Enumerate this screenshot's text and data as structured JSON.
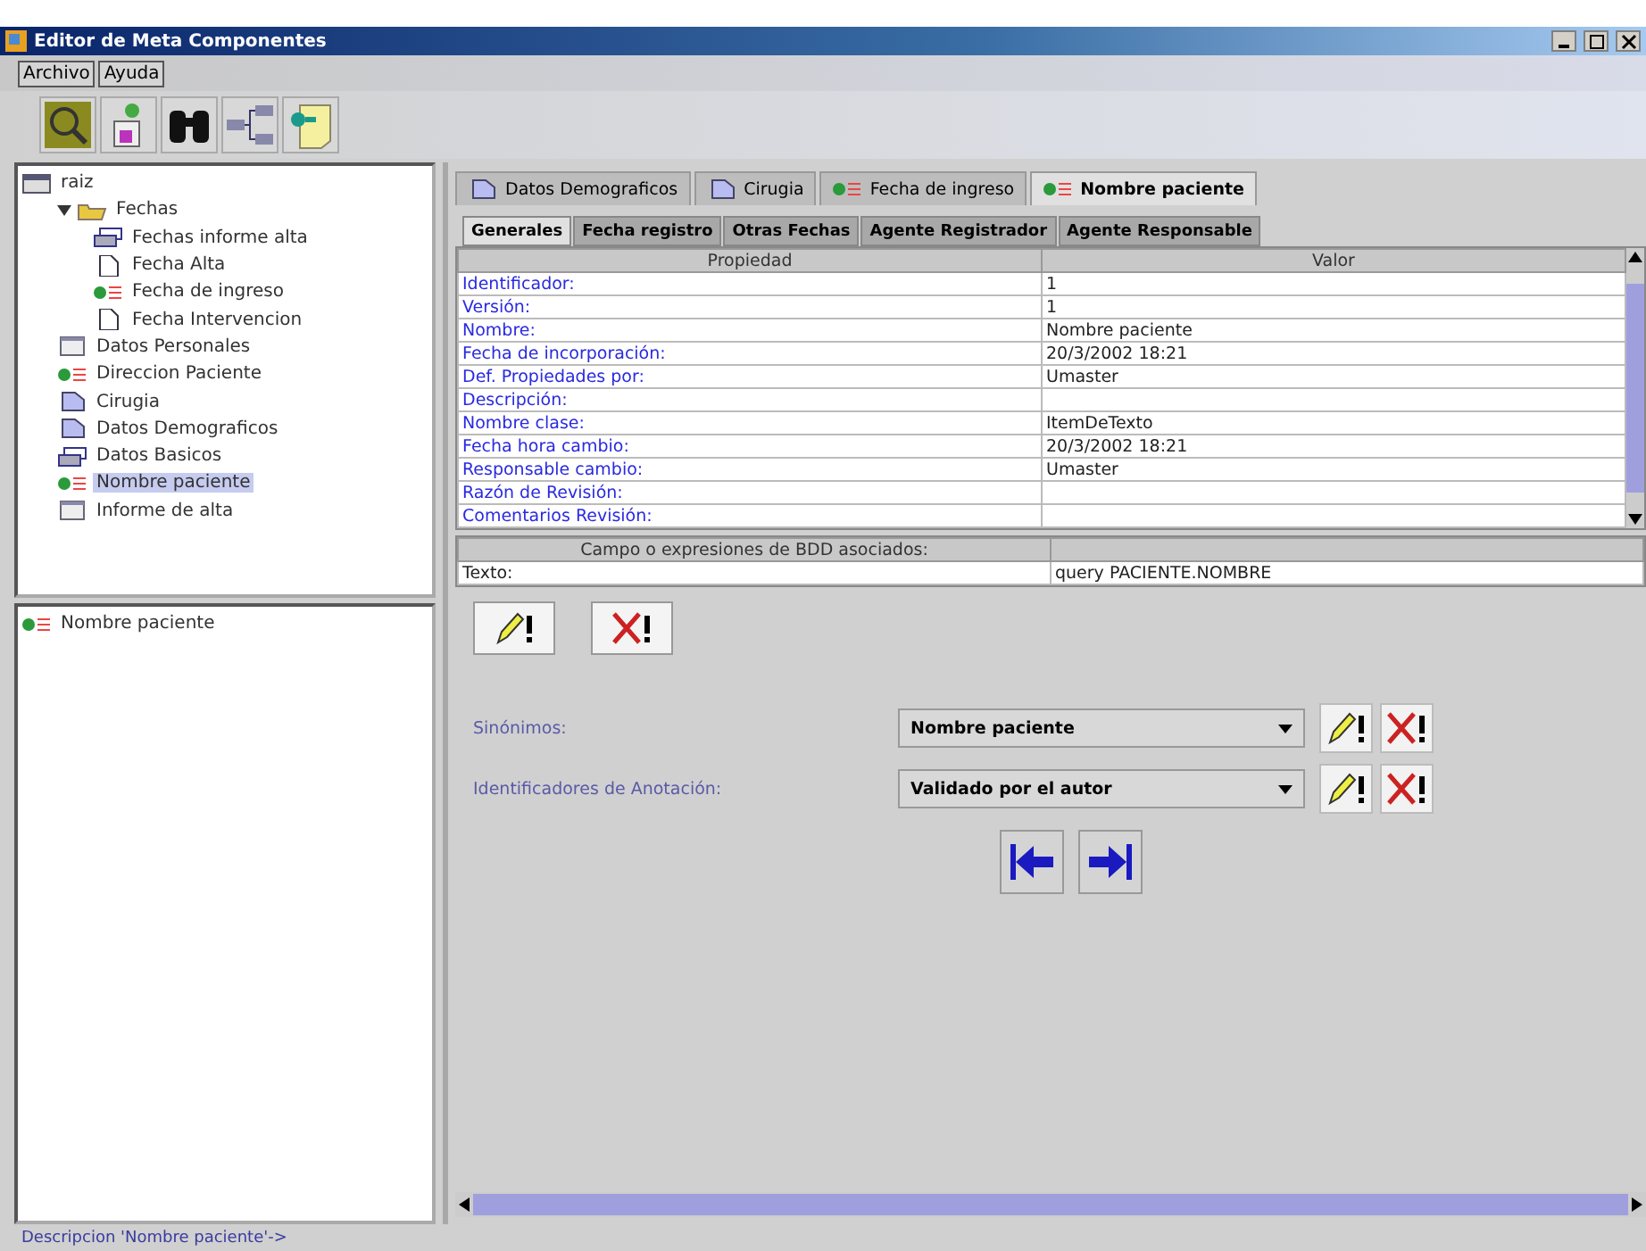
{
  "window": {
    "title": "Editor de Meta Componentes"
  },
  "menu": [
    "Archivo",
    "Ayuda"
  ],
  "toolbar": [
    {
      "kind": "search"
    },
    {
      "kind": "people"
    },
    {
      "kind": "binoculars"
    },
    {
      "kind": "network"
    },
    {
      "kind": "note"
    }
  ],
  "tree": {
    "label": "raiz",
    "kind": "root",
    "children": [
      {
        "label": "Fechas",
        "kind": "group",
        "expanded": true,
        "selected": false,
        "children": [
          {
            "label": "Fechas informe alta",
            "kind": "stack",
            "selected": false
          },
          {
            "label": "Fecha Alta",
            "kind": "doc",
            "selected": false
          },
          {
            "label": "Fecha de ingreso",
            "kind": "tag",
            "selected": false
          },
          {
            "label": "Fecha Intervencion",
            "kind": "doc",
            "selected": false
          }
        ]
      },
      {
        "label": "Datos Personales",
        "kind": "table",
        "selected": false
      },
      {
        "label": "Direccion Paciente",
        "kind": "tag",
        "selected": false
      },
      {
        "label": "Cirugia",
        "kind": "folder",
        "selected": false
      },
      {
        "label": "Datos Demograficos",
        "kind": "folder",
        "selected": false
      },
      {
        "label": "Datos Basicos",
        "kind": "stack",
        "selected": false
      },
      {
        "label": "Nombre paciente",
        "kind": "tag",
        "selected": true
      },
      {
        "label": "Informe de alta",
        "kind": "table",
        "selected": false
      }
    ]
  },
  "detail_list": [
    {
      "label": "Nombre paciente",
      "kind": "tag"
    }
  ],
  "tabs": [
    {
      "label": "Datos Demograficos",
      "kind": "folder",
      "selected": false
    },
    {
      "label": "Cirugia",
      "kind": "folder",
      "selected": false
    },
    {
      "label": "Fecha de ingreso",
      "kind": "tag",
      "selected": false
    },
    {
      "label": "Nombre paciente",
      "kind": "tag",
      "selected": true
    }
  ],
  "subtabs": [
    {
      "label": "Generales",
      "selected": true
    },
    {
      "label": "Fecha registro",
      "selected": false
    },
    {
      "label": "Otras Fechas",
      "selected": false
    },
    {
      "label": "Agente Registrador",
      "selected": false
    },
    {
      "label": "Agente Responsable",
      "selected": false
    }
  ],
  "properties": {
    "columns": [
      "Propiedad",
      "Valor"
    ],
    "rows": [
      [
        "Identificador:",
        "1"
      ],
      [
        "Versión:",
        "1"
      ],
      [
        "Nombre:",
        "Nombre paciente"
      ],
      [
        "Fecha de incorporación:",
        "20/3/2002 18:21"
      ],
      [
        "Def. Propiedades por:",
        "Umaster"
      ],
      [
        "Descripción:",
        ""
      ],
      [
        "Nombre clase:",
        "ItemDeTexto"
      ],
      [
        "Fecha hora cambio:",
        "20/3/2002 18:21"
      ],
      [
        "Responsable cambio:",
        "Umaster"
      ],
      [
        "Razón de Revisión:",
        ""
      ],
      [
        "Comentarios Revisión:",
        ""
      ]
    ]
  },
  "fields_table": {
    "columns": [
      "Campo o expresiones de BDD asociados:"
    ],
    "rows": [
      [
        "Texto:",
        "query PACIENTE.NOMBRE"
      ]
    ]
  },
  "form": [
    {
      "label": "Sinónimos:",
      "value": "Nombre paciente"
    },
    {
      "label": "Identificadores de Anotación:",
      "value": "Validado por el autor"
    }
  ],
  "status_bar": "Descripcion 'Nombre paciente'->"
}
